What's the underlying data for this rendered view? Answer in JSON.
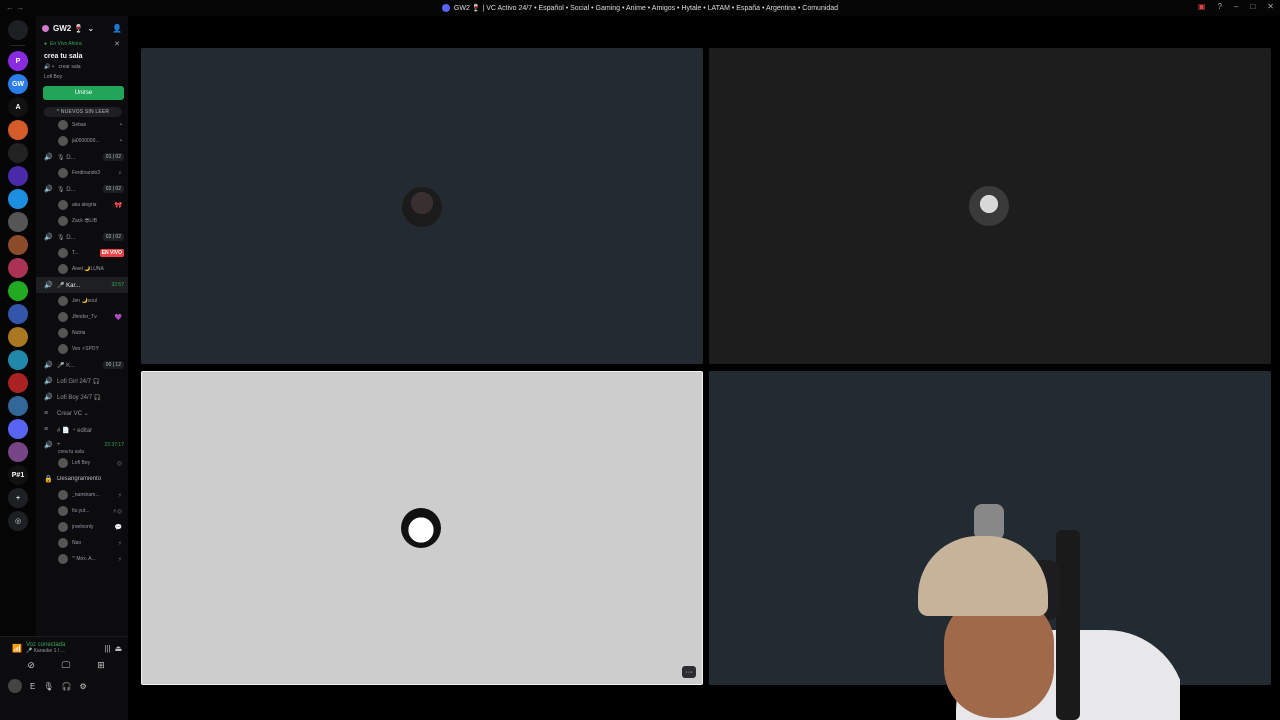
{
  "window": {
    "title": "GW2 🍷 | VC Activo 24/7 • Español • Social • Gaming • Anime • Amigos • Hytale • LATAM • España • Argentina • Comunidad"
  },
  "rail": {
    "items": [
      {
        "label": "",
        "color": "#1e1f22"
      },
      {
        "label": "P",
        "color": "#8a2be2"
      },
      {
        "label": "GW",
        "color": "#2b7de9"
      },
      {
        "label": "A",
        "color": "#111111"
      },
      {
        "label": "",
        "color": "#d45b2a"
      },
      {
        "label": "",
        "color": "#222222"
      },
      {
        "label": "",
        "color": "#4a2aa8"
      },
      {
        "label": "",
        "color": "#1d8fe0"
      },
      {
        "label": "",
        "color": "#555555"
      },
      {
        "label": "",
        "color": "#8b4a2a"
      },
      {
        "label": "",
        "color": "#aa3355"
      },
      {
        "label": "",
        "color": "#22aa22"
      },
      {
        "label": "",
        "color": "#3355aa"
      },
      {
        "label": "",
        "color": "#aa7722"
      },
      {
        "label": "",
        "color": "#2288aa"
      },
      {
        "label": "",
        "color": "#aa2222"
      },
      {
        "label": "",
        "color": "#336699"
      },
      {
        "label": "",
        "color": "#5865f2"
      },
      {
        "label": "",
        "color": "#774488"
      },
      {
        "label": "P#1",
        "color": "#111111"
      }
    ]
  },
  "sidebar": {
    "server_name": "GW2 🍷",
    "live_tag": "En Vivo Ahora",
    "live_room": "crea tu sala",
    "live_sub": "crear sala",
    "live_user": "Lofi Boy",
    "join_label": "Unirse",
    "new_unread": "^ NUEVOS SIN LEER",
    "channels": [
      {
        "type": "user",
        "name": "Sebas",
        "right": "▪"
      },
      {
        "type": "user",
        "name": "ja0000000...",
        "right": "▪"
      },
      {
        "type": "channel",
        "name": "🎙 D...",
        "count": "01 | 02"
      },
      {
        "type": "user",
        "name": "Ferdinando3",
        "right": "⚡"
      },
      {
        "type": "channel",
        "name": "🎙 D...",
        "count": "02 | 02"
      },
      {
        "type": "user",
        "name": "aka alegria",
        "right": "🎀"
      },
      {
        "type": "user",
        "name": "Zack 😎LIB",
        "right": ""
      },
      {
        "type": "channel",
        "name": "🎙 D...",
        "count": "02 | 02"
      },
      {
        "type": "user_live",
        "name": "T...",
        "live": "EN VIVO"
      },
      {
        "type": "user",
        "name": "Aisel 🌙LUNA",
        "right": ""
      },
      {
        "type": "channel_active",
        "name": "🎤 Kar...",
        "timer": "32:57"
      },
      {
        "type": "user",
        "name": "Jen 🌙soul",
        "right": ""
      },
      {
        "type": "user",
        "name": "Jhinder_Tv",
        "right": "💜"
      },
      {
        "type": "user",
        "name": "Nutria",
        "right": ""
      },
      {
        "type": "user",
        "name": "Vex ⚡SPDY",
        "right": ""
      },
      {
        "type": "channel",
        "name": "🎤 K...",
        "count": "00 | 12"
      },
      {
        "type": "channel_plain",
        "name": "Lofi Girl 24/7 🎧"
      },
      {
        "type": "channel_plain",
        "name": "Lofi Boy 24/7 🎧"
      },
      {
        "type": "text",
        "name": "Crear VC ⌄"
      },
      {
        "type": "text",
        "name": "# 📄 ・editar"
      },
      {
        "type": "channel_timer",
        "name": "+",
        "timer": "23:37:17"
      },
      {
        "type": "user",
        "name": "Lofi Boy",
        "right": "◎"
      },
      {
        "type": "locked",
        "name": "Desangramiento"
      },
      {
        "type": "user",
        "name": "_naminam...",
        "right": "⚡"
      },
      {
        "type": "user",
        "name": "Its.yut...",
        "right": "⚡◎"
      },
      {
        "type": "user",
        "name": "jroelnonly",
        "right": "💬"
      },
      {
        "type": "user",
        "name": "Nao",
        "right": "⚡"
      },
      {
        "type": "user",
        "name": "'° Mox. A...",
        "right": "⚡"
      }
    ],
    "crea_tu_sala": "crea tu sala"
  },
  "voice": {
    "status": "Voz conectada",
    "channel": "🎤 Karaoke 1 / ...",
    "user_label": "E"
  },
  "colors": {
    "voice_green": "#3ba55d",
    "join_button": "#23a559",
    "live_red": "#ed4245"
  },
  "stage": {
    "more_label": "···"
  }
}
